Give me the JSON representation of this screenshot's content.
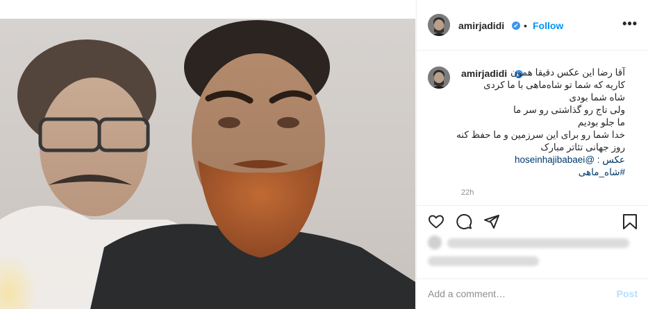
{
  "post": {
    "username": "amirjadidi",
    "verified_mark": "✔",
    "separator": "•",
    "follow_label": "Follow",
    "more_label": "•••",
    "caption_lines": [
      "آقا رضا این عکس دقیقا همون",
      "کاریه که شما تو شاه‌ماهی با ما کردی",
      "شاه شما بودی",
      "ولی تاج رو گذاشتی رو سر ما",
      "ما جلو بودیم",
      "خدا شما رو برای این سرزمین و ما حفظ کنه",
      "روز جهانی تئاتر مبارک",
      "عکس : @hoseinhajibabaei",
      "#شاه_ماهی"
    ],
    "time": "22h",
    "add_comment_placeholder": "Add a comment…",
    "post_label": "Post"
  },
  "icons": {
    "like": "heart-icon",
    "comment": "comment-icon",
    "share": "share-icon",
    "save": "bookmark-icon",
    "more": "more-options-icon"
  },
  "colors": {
    "accent": "#0095f6",
    "verified": "#3897f0",
    "link": "#00376b",
    "muted": "#8e8e8e",
    "post_disabled": "#b2dffc",
    "beard": "#a8552a"
  }
}
